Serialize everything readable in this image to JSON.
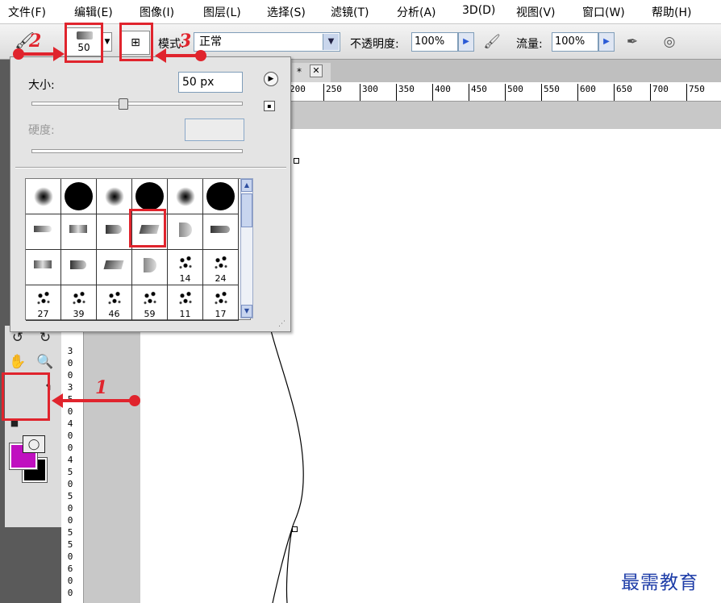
{
  "menu": [
    "文件(F)",
    "编辑(E)",
    "图像(I)",
    "图层(L)",
    "选择(S)",
    "滤镜(T)",
    "分析(A)",
    "3D(D)",
    "视图(V)",
    "窗口(W)",
    "帮助(H)"
  ],
  "options_bar": {
    "brush_preset_size": "50",
    "mode_label": "模式:",
    "mode_value": "正常",
    "opacity_label": "不透明度:",
    "opacity_value": "100%",
    "flow_label": "流量:",
    "flow_value": "100%",
    "icons": [
      "brush-tool-icon",
      "brush-panel-toggle-icon",
      "airbrush-icon",
      "tablet-pressure-icon"
    ]
  },
  "document_tab": {
    "title_suffix": "* ",
    "close": "✕"
  },
  "ruler_h_ticks": [
    "200",
    "250",
    "300",
    "350",
    "400",
    "450",
    "500",
    "550",
    "600",
    "650",
    "700",
    "750"
  ],
  "ruler_v_digits": [
    "3",
    "0",
    "0",
    "3",
    "5",
    "0",
    "4",
    "0",
    "0",
    "4",
    "5",
    "0",
    "5",
    "0",
    "0",
    "5",
    "5",
    "0",
    "6",
    "0",
    "0"
  ],
  "brush_panel": {
    "size_label": "大小:",
    "size_value": "50 px",
    "hardness_label": "硬度:",
    "brushes": [
      {
        "kind": "soft-round",
        "label": ""
      },
      {
        "kind": "hard-round",
        "label": ""
      },
      {
        "kind": "soft-round",
        "label": ""
      },
      {
        "kind": "hard-round",
        "label": ""
      },
      {
        "kind": "soft-round",
        "label": ""
      },
      {
        "kind": "hard-round",
        "label": ""
      },
      {
        "kind": "tip-pointed",
        "label": ""
      },
      {
        "kind": "tip-flat",
        "label": ""
      },
      {
        "kind": "tip-round",
        "label": ""
      },
      {
        "kind": "tip-angled",
        "label": "",
        "selected": true
      },
      {
        "kind": "tip-fan",
        "label": ""
      },
      {
        "kind": "tip-wedge",
        "label": ""
      },
      {
        "kind": "tip-flat",
        "label": ""
      },
      {
        "kind": "tip-round",
        "label": ""
      },
      {
        "kind": "tip-angled",
        "label": ""
      },
      {
        "kind": "tip-fan",
        "label": ""
      },
      {
        "kind": "scatter",
        "label": "14"
      },
      {
        "kind": "scatter",
        "label": "24"
      },
      {
        "kind": "scatter",
        "label": "27"
      },
      {
        "kind": "scatter",
        "label": "39"
      },
      {
        "kind": "scatter",
        "label": "46"
      },
      {
        "kind": "scatter",
        "label": "59"
      },
      {
        "kind": "scatter",
        "label": "11"
      },
      {
        "kind": "scatter",
        "label": "17"
      }
    ]
  },
  "colors": {
    "foreground": "#c010c0",
    "background": "#000000",
    "accent": "#e0242d",
    "watermark": "#1e3da8"
  },
  "annotations": [
    "1",
    "2",
    "3"
  ],
  "watermark": "最需教育"
}
